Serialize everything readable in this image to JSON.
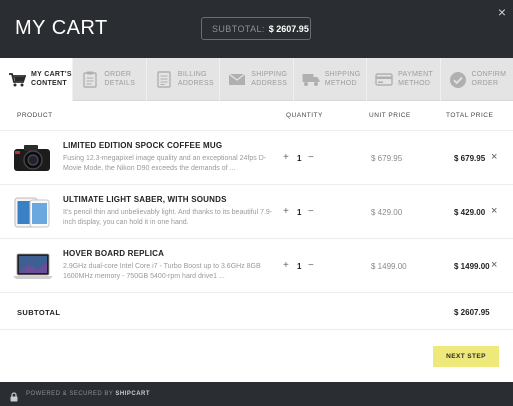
{
  "header": {
    "title": "MY CART",
    "subtotal_label": "SUBTOTAL:",
    "subtotal_value": "$ 2607.95",
    "close_glyph": "×"
  },
  "steps": [
    {
      "line1": "MY CART'S",
      "line2": "CONTENT",
      "icon": "cart-icon",
      "active": true
    },
    {
      "line1": "ORDER",
      "line2": "DETAILS",
      "icon": "clipboard-icon",
      "active": false
    },
    {
      "line1": "BILLING",
      "line2": "ADDRESS",
      "icon": "document-icon",
      "active": false
    },
    {
      "line1": "SHIPPING",
      "line2": "ADDRESS",
      "icon": "envelope-icon",
      "active": false
    },
    {
      "line1": "SHIPPING",
      "line2": "METHOD",
      "icon": "truck-icon",
      "active": false
    },
    {
      "line1": "PAYMENT",
      "line2": "METHOD",
      "icon": "credit-card-icon",
      "active": false
    },
    {
      "line1": "CONFIRM",
      "line2": "ORDER",
      "icon": "checkmark-icon",
      "active": false
    }
  ],
  "table": {
    "headers": {
      "product": "PRODUCT",
      "quantity": "QUANTITY",
      "unit_price": "UNIT PRICE",
      "total_price": "TOTAL PRICE"
    },
    "rows": [
      {
        "name": "LIMITED EDITION SPOCK COFFEE MUG",
        "desc": "Fusing 12.3-megapixel image quality and an exceptional 24fps D-Movie Mode, the Nikon D90 exceeds the demands of ...",
        "qty": "1",
        "unit_price": "$ 679.95",
        "total_price": "$ 679.95",
        "image_icon": "camera-icon"
      },
      {
        "name": "ULTIMATE LIGHT SABER, WITH SOUNDS",
        "desc": "It's pencil thin and unbelievably light. And thanks to its beautiful 7.9-inch display, you can hold it in one hand.",
        "qty": "1",
        "unit_price": "$ 429.00",
        "total_price": "$ 429.00",
        "image_icon": "tablet-icon"
      },
      {
        "name": "HOVER BOARD REPLICA",
        "desc": "2.9GHz dual-core Intel Core i7 - Turbo Boost up to 3.6GHz 8GB 1600MHz memory - 750GB 5400-rpm hard drive1 ...",
        "qty": "1",
        "unit_price": "$ 1499.00",
        "total_price": "$ 1499.00",
        "image_icon": "laptop-icon"
      }
    ],
    "controls": {
      "plus": "+",
      "minus": "−",
      "remove": "×"
    }
  },
  "summary": {
    "label": "SUBTOTAL",
    "value": "$ 2607.95"
  },
  "next_button": "NEXT STEP",
  "footer": {
    "text": "POWERED & SECURED BY",
    "brand": "SHIPCART"
  },
  "colors": {
    "header_bg": "#2a2d31",
    "steps_bg": "#e4e4e4",
    "accent_button": "#efe87a",
    "muted_text": "#9a9a9a"
  }
}
